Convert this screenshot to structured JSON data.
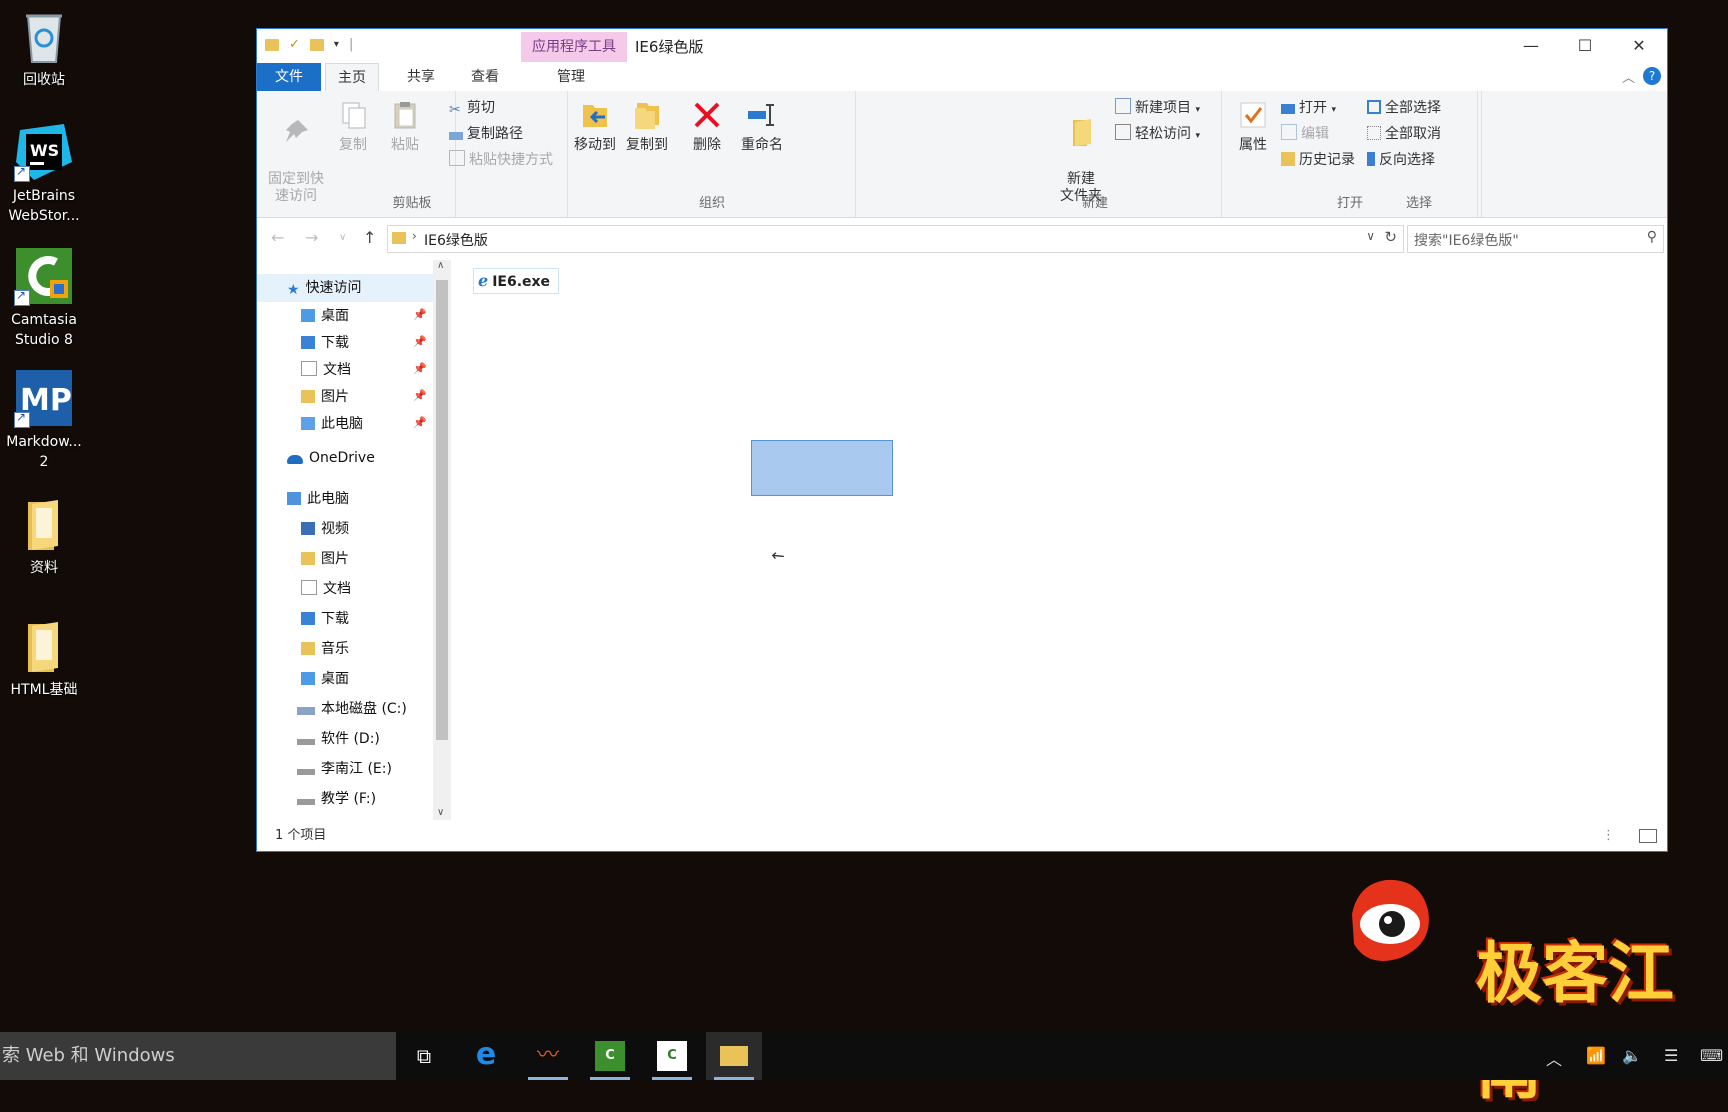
{
  "desktop": {
    "icons": [
      {
        "label": "回收站"
      },
      {
        "label": "JetBrains\nWebStor..."
      },
      {
        "label": "Camtasia\nStudio 8"
      },
      {
        "label": "Markdow...\n2"
      },
      {
        "label": "资料"
      },
      {
        "label": "HTML基础"
      }
    ]
  },
  "window": {
    "context_tool_label": "应用程序工具",
    "title": "IE6绿色版",
    "tabs": {
      "file": "文件",
      "home": "主页",
      "share": "共享",
      "view": "查看",
      "manage": "管理"
    },
    "ribbon": {
      "clipboard": {
        "pin_label": "固定到快\n速访问",
        "copy_label": "复制",
        "paste_label": "粘贴",
        "cut_label": "剪切",
        "copy_path_label": "复制路径",
        "paste_shortcut_label": "粘贴快捷方式",
        "group_label": "剪贴板"
      },
      "organize": {
        "move_to_label": "移动到",
        "copy_to_label": "复制到",
        "delete_label": "删除",
        "rename_label": "重命名",
        "group_label": "组织"
      },
      "new": {
        "new_folder_label": "新建\n文件夹",
        "new_item_label": "新建项目",
        "easy_access_label": "轻松访问",
        "group_label": "新建"
      },
      "open": {
        "properties_label": "属性",
        "open_label": "打开",
        "edit_label": "编辑",
        "history_label": "历史记录",
        "group_label": "打开"
      },
      "select": {
        "select_all_label": "全部选择",
        "select_none_label": "全部取消",
        "invert_label": "反向选择",
        "group_label": "选择"
      }
    },
    "address": {
      "path": "IE6绿色版",
      "search_placeholder": "搜索\"IE6绿色版\""
    },
    "nav": {
      "quick_access": "快速访问",
      "quick_items": [
        "桌面",
        "下载",
        "文档",
        "图片",
        "此电脑"
      ],
      "onedrive": "OneDrive",
      "this_pc": "此电脑",
      "pc_items": [
        "视频",
        "图片",
        "文档",
        "下载",
        "音乐",
        "桌面"
      ],
      "drives": [
        "本地磁盘 (C:)",
        "软件 (D:)",
        "李南江 (E:)",
        "教学 (F:)"
      ]
    },
    "files": [
      {
        "name": "IE6.exe"
      }
    ],
    "status": "1 个项目"
  },
  "taskbar": {
    "search_text": "索 Web 和 Windows"
  },
  "watermark": {
    "text": "极客江南"
  },
  "colors": {
    "accent": "#1c6fc6",
    "context_tab": "#f5c9ea",
    "selection": "#a9c9ee",
    "delete_red": "#e81123"
  }
}
